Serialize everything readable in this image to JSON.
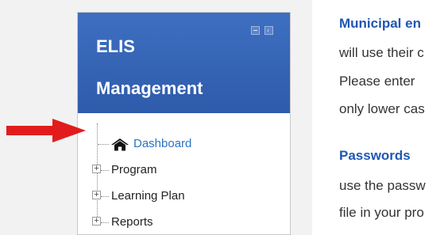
{
  "block": {
    "title_line1": "ELIS",
    "title_line2": "Management",
    "items": [
      {
        "label": "Dashboard"
      },
      {
        "label": "Program"
      },
      {
        "label": "Learning Plan"
      },
      {
        "label": "Reports"
      }
    ]
  },
  "content": {
    "heading1": "Municipal en",
    "line1": "will use their c",
    "line2": "Please enter",
    "line3": "only lower cas",
    "heading2": "Passwords",
    "line4": "use the passw",
    "line5": "file in your pro"
  },
  "colors": {
    "header_blue": "#3565b9",
    "link_blue": "#2a73c4",
    "heading_blue": "#1f57b3",
    "arrow_red": "#e21c1c"
  },
  "icons": [
    "minimize-icon",
    "dock-icon",
    "home-icon",
    "expand-plus-icon",
    "red-arrow-icon"
  ]
}
